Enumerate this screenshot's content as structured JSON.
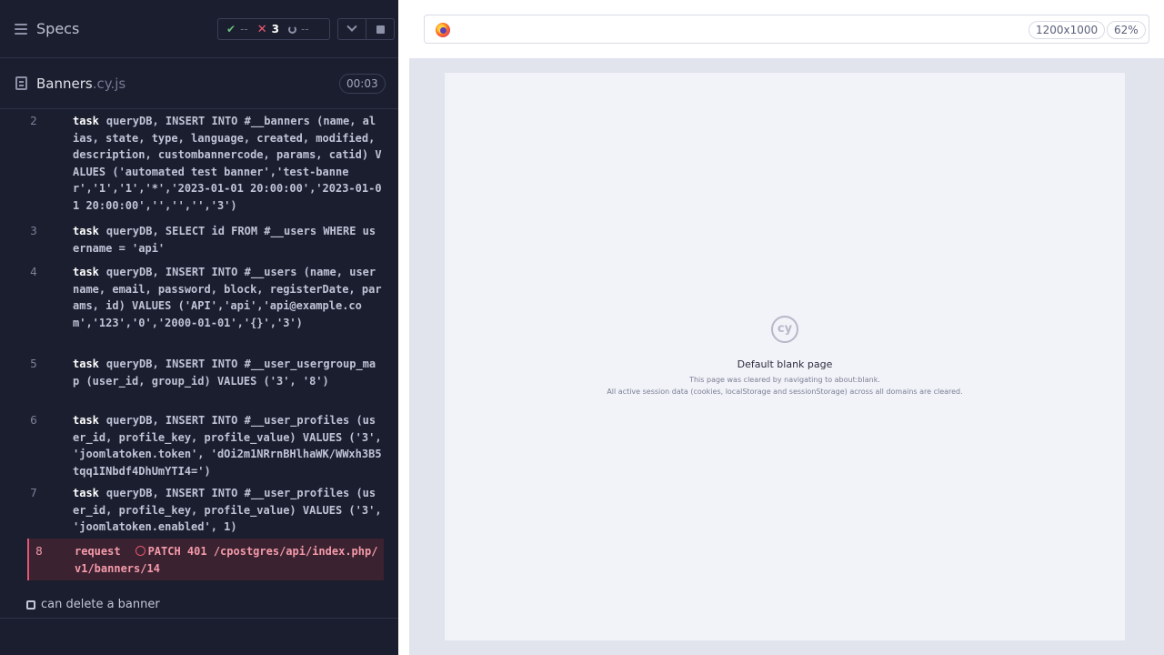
{
  "header": {
    "specs_label": "Specs",
    "stats": {
      "passed": "--",
      "failed": "3",
      "pending": "--"
    }
  },
  "file": {
    "name": "Banners",
    "ext": ".cy.js",
    "duration": "00:03"
  },
  "commands": [
    {
      "num": "2",
      "name": "task",
      "message": "queryDB, INSERT INTO #__banners (name, alias, state, type, language, created, modified, description, custombannercode, params, catid) VALUES ('automated test banner','test-banner','1','1','*','2023-01-01 20:00:00','2023-01-01 20:00:00','','','','3')"
    },
    {
      "num": "3",
      "name": "task",
      "message": "queryDB, SELECT id FROM #__users WHERE username = 'api'"
    },
    {
      "num": "4",
      "name": "task",
      "message": "queryDB, INSERT INTO #__users (name, username, email, password, block, registerDate, params, id) VALUES ('API','api','api@example.com','123','0','2000-01-01','{}','3')"
    },
    {
      "num": "5",
      "name": "task",
      "message": "queryDB, INSERT INTO #__user_usergroup_map (user_id, group_id) VALUES ('3', '8')"
    },
    {
      "num": "6",
      "name": "task",
      "message": "queryDB, INSERT INTO #__user_profiles (user_id, profile_key, profile_value) VALUES ('3', 'joomlatoken.token', 'dOi2m1NRrnBHlhaWK/WWxh3B5tqq1INbdf4DhUmYTI4=')"
    },
    {
      "num": "7",
      "name": "task",
      "message": "queryDB, INSERT INTO #__user_profiles (user_id, profile_key, profile_value) VALUES ('3', 'joomlatoken.enabled', 1)"
    },
    {
      "num": "8",
      "name": "request",
      "message": "PATCH 401 /cpostgres/api/index.php/v1/banners/14"
    }
  ],
  "next_test": "can delete a banner",
  "aut": {
    "viewport": "1200x1000",
    "zoom": "62%",
    "blank_title": "Default blank page",
    "blank_line1": "This page was cleared by navigating to about:blank.",
    "blank_line2": "All active session data (cookies, localStorage and sessionStorage) across all domains are cleared.",
    "logo_text": "cy"
  }
}
